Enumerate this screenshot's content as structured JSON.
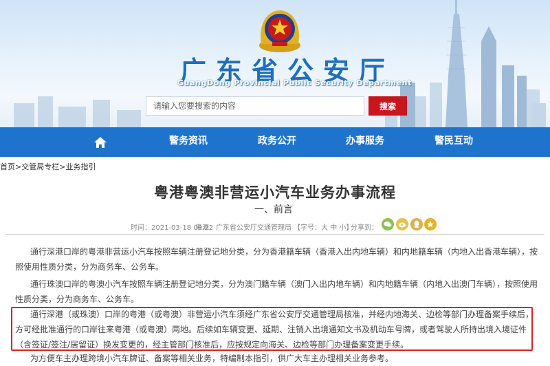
{
  "header": {
    "site_title": "广东省公安厅",
    "site_subtitle": "GuangDong Provincial Public Security Department",
    "search": {
      "placeholder": "请输入您要搜索的内容",
      "button_label": "搜索"
    },
    "icons": [
      "police-emblem-icon",
      "home-icon"
    ]
  },
  "nav": {
    "home_icon": "home-icon",
    "items": [
      {
        "label": "警务资讯"
      },
      {
        "label": "政务公开"
      },
      {
        "label": "办事服务"
      },
      {
        "label": "警民互动"
      }
    ]
  },
  "breadcrumb": [
    {
      "label": "首页"
    },
    {
      "label": "交管局专栏"
    },
    {
      "label": "业务指引"
    }
  ],
  "breadcrumb_separator": " > ",
  "article": {
    "title": "粤港粤澳非营运小汽车业务办事流程",
    "section_heading": "一、前言",
    "meta": {
      "time": "时间：2021-03-18 09:22",
      "source": "来源：广东省公安厅交通管理局",
      "font_size_label": "【字号：",
      "font_large": "大",
      "font_medium": "中",
      "font_small": "小",
      "font_close": "】",
      "share_label": "分享到："
    },
    "share_icons": [
      "wechat-icon",
      "weibo-icon",
      "qq-icon",
      "qzone-icon"
    ],
    "paragraphs": [
      "通行深港口岸的粤港非营运小汽车按照车辆注册登记地分类，分为香港籍车辆（香港入出内地车辆）和内地籍车辆（内地入出香港车辆），按照使用性质分类，分为商务车、公务车。",
      "通行珠澳口岸的粤澳小汽车按照车辆注册登记地分类，分为澳门籍车辆（澳门入出内地车辆）和内地籍车辆（内地入出澳门车辆），按照使用性质分类，分为商务车、公务车。",
      "通行深港（或珠澳）口岸的粤港（或粤澳）非营运小汽车须经广东省公安厅交通管理局核准，并经内地海关、边检等部门办理备案手续后，方可经批准通行的口岸往来粤港（或粤澳）两地。后续如车辆变更、延期、注销入出境通知文书及机动车号牌，或者驾驶人所持出境入境证件（含签证/签注/居留证）换发变更的，经主管部门核准后，应按规定向海关、边检等部门办理备案变更手续。",
      "为方便车主办理跨境小汽车牌证、备案等相关业务，特编制本指引，供广大车主办理相关业务参考。"
    ]
  },
  "colors": {
    "nav_bg": "#1e74cc",
    "title_blue": "#1b6fc2",
    "search_button": "#c9151e",
    "highlight_border": "#e02020"
  }
}
